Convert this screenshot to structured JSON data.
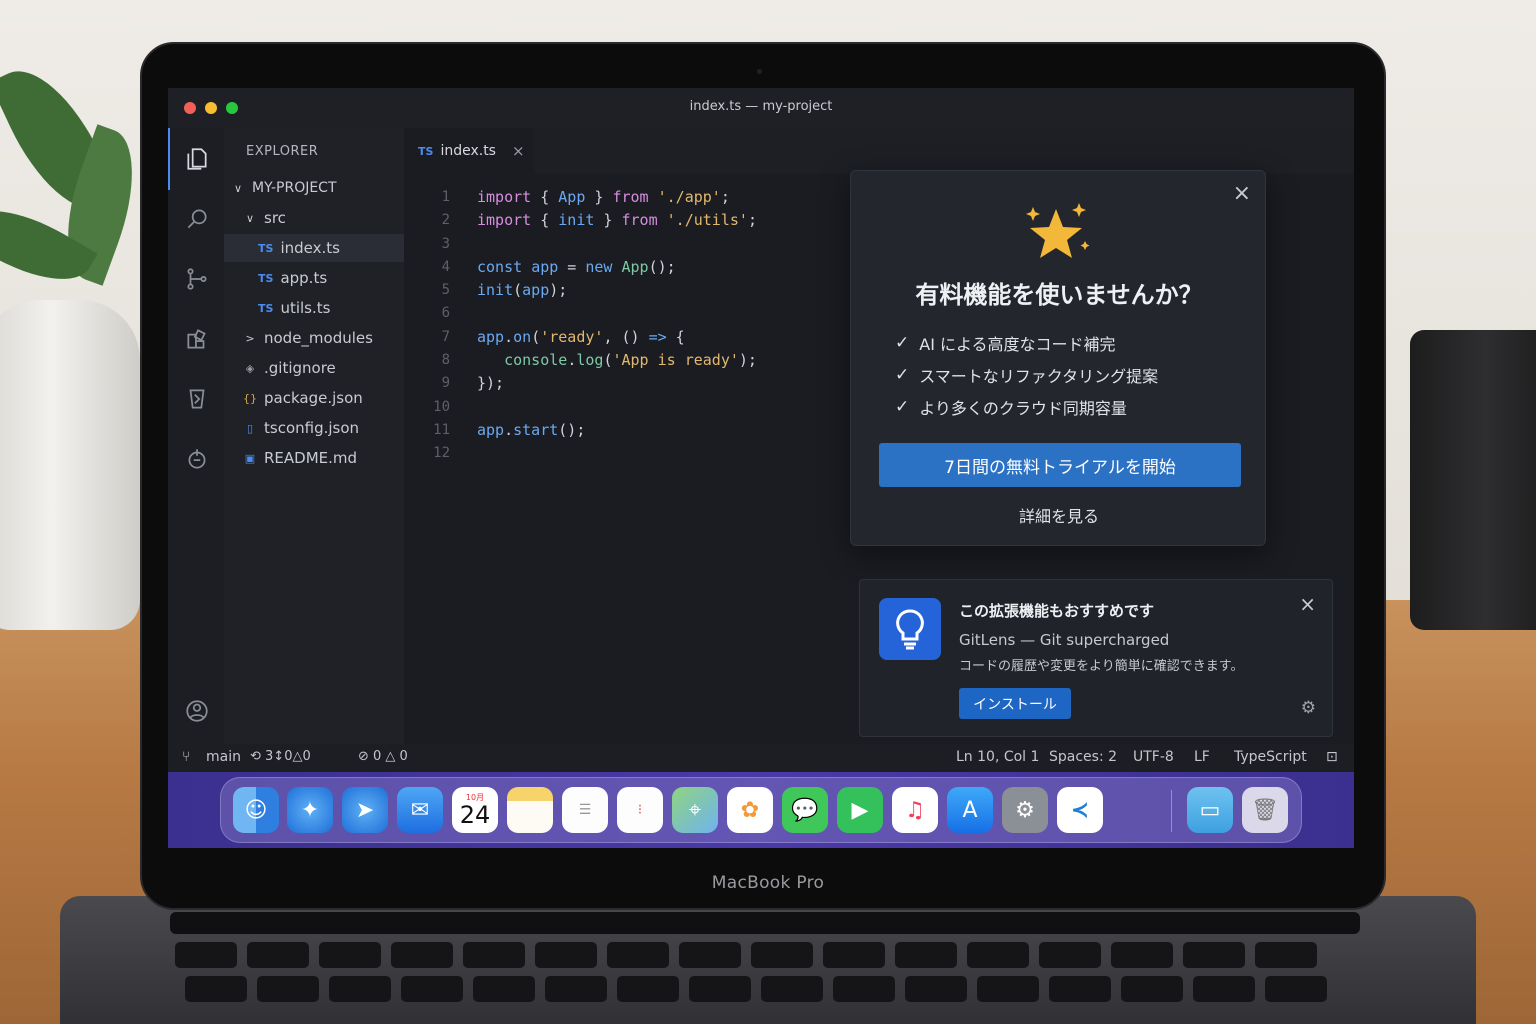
{
  "device": {
    "label": "MacBook Pro"
  },
  "window": {
    "title": "index.ts — my-project"
  },
  "explorer": {
    "header": "EXPLORER",
    "project": "MY-PROJECT",
    "items": [
      {
        "label": "src",
        "glyph": "∨",
        "type": "folder-open"
      },
      {
        "label": "index.ts",
        "glyph": "TS",
        "type": "ts",
        "selected": true
      },
      {
        "label": "app.ts",
        "glyph": "TS",
        "type": "ts"
      },
      {
        "label": "utils.ts",
        "glyph": "TS",
        "type": "ts"
      },
      {
        "label": "node_modules",
        "glyph": ">",
        "type": "folder"
      },
      {
        "label": ".gitignore",
        "glyph": "◈",
        "type": "file"
      },
      {
        "label": "package.json",
        "glyph": "{}",
        "type": "json"
      },
      {
        "label": "tsconfig.json",
        "glyph": "▯",
        "type": "json"
      },
      {
        "label": "README.md",
        "glyph": "▣",
        "type": "md"
      }
    ]
  },
  "editor": {
    "tab": {
      "badge": "TS",
      "label": "index.ts",
      "close": "×"
    },
    "line_numbers": [
      "1",
      "2",
      "3",
      "4",
      "5",
      "6",
      "7",
      "8",
      "9",
      "10",
      "11",
      "12"
    ]
  },
  "promo": {
    "title": "有料機能を使いませんか？",
    "features": [
      "AI による高度なコード補完",
      "スマートなリファクタリング提案",
      "より多くのクラウド同期容量"
    ],
    "primary_button": "7日間の無料トライアルを開始",
    "secondary_link": "詳細を見る",
    "close": "×"
  },
  "notification": {
    "title": "この拡張機能もおすすめです",
    "subtitle": "GitLens — Git supercharged",
    "description": "コードの履歴や変更をより簡単に確認できます。",
    "install_button": "インストール",
    "close": "×",
    "settings": "⚙"
  },
  "statusbar": {
    "branch": "main",
    "sync": "⟲ 3↕0△0",
    "problems": "⊘ 0 △ 0",
    "position": "Ln 10, Col 1",
    "spaces": "Spaces: 2",
    "encoding": "UTF-8",
    "eol": "LF",
    "language": "TypeScript"
  },
  "dock": {
    "calendar_day": "24",
    "calendar_month": "10月",
    "apps": [
      "finder-icon",
      "safari-icon",
      "safari-alt-icon",
      "mail-icon",
      "calendar-icon",
      "notes-icon",
      "reminders-icon",
      "reminders-alt-icon",
      "maps-icon",
      "photos-icon",
      "messages-icon",
      "facetime-icon",
      "music-icon",
      "app-store-icon",
      "system-settings-icon",
      "vscode-icon",
      "folder-icon",
      "trash-icon"
    ]
  },
  "colors": {
    "accent": "#2c72c4",
    "install": "#1e66c4",
    "dock": "#4a3aa8"
  }
}
